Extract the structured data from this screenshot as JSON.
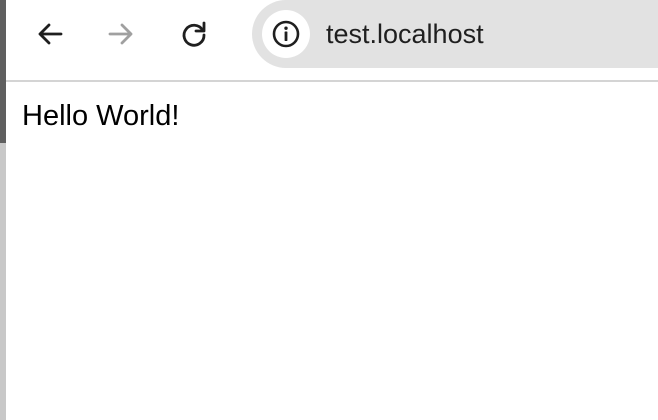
{
  "browser": {
    "nav": {
      "back_icon": "arrow-left-icon",
      "forward_icon": "arrow-right-icon",
      "reload_icon": "reload-icon"
    },
    "address_bar": {
      "url": "test.localhost",
      "site_info_icon": "info-icon"
    },
    "colors": {
      "toolbar_bg": "#ffffff",
      "omnibox_bg": "#e2e2e2",
      "icon_active": "#1f1f1f",
      "icon_disabled": "#a0a0a0"
    }
  },
  "page": {
    "body_text": "Hello World!"
  }
}
